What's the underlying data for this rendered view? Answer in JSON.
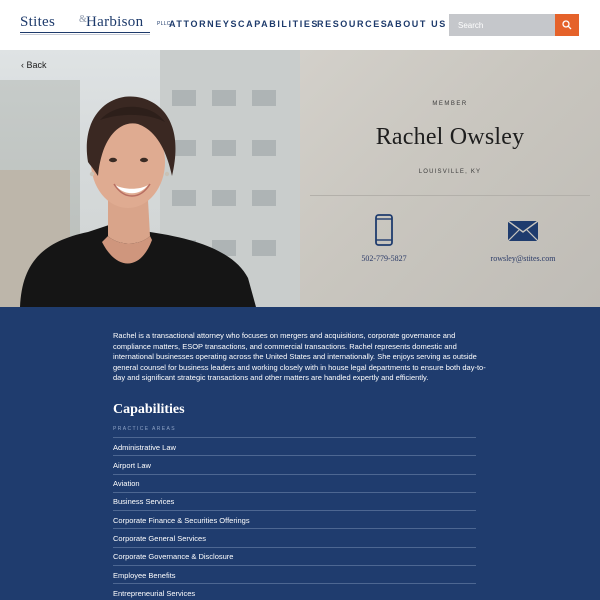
{
  "header": {
    "logo": {
      "word1": "Stites",
      "amp": "&",
      "word2": "Harbison",
      "suffix": "PLLC"
    },
    "nav": [
      "ATTORNEYS",
      "CAPABILITIES",
      "RESOURCES",
      "ABOUT US"
    ],
    "search": {
      "placeholder": "Search",
      "icon": "search-icon"
    }
  },
  "hero": {
    "back_label": "Back",
    "member_label": "MEMBER",
    "name": "Rachel Owsley",
    "location": "LOUISVILLE, KY",
    "phone": "502-779-5827",
    "email": "rowsley@stites.com"
  },
  "bio": "Rachel is a transactional attorney who focuses on mergers and acquisitions, corporate governance and compliance matters, ESOP transactions, and commercial transactions. Rachel represents domestic and international businesses operating across the United States and internationally. She enjoys serving as outside general counsel for business leaders and working closely with in house legal departments to ensure both day-to-day and significant strategic transactions and other matters are handled expertly and efficiently.",
  "capabilities": {
    "title": "Capabilities",
    "subtitle": "PRACTICE AREAS",
    "items": [
      "Administrative Law",
      "Airport Law",
      "Aviation",
      "Business Services",
      "Corporate Finance & Securities Offerings",
      "Corporate General Services",
      "Corporate Governance & Disclosure",
      "Employee Benefits",
      "Entrepreneurial Services"
    ]
  },
  "colors": {
    "navy": "#1f3c6e",
    "accent_orange": "#e5622a"
  }
}
